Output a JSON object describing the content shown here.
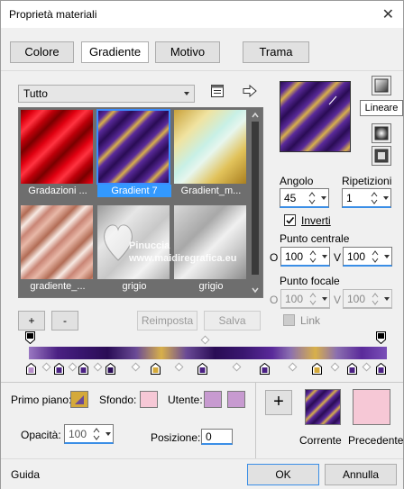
{
  "window": {
    "title": "Proprietà materiali",
    "close_glyph": "✕"
  },
  "tabs": [
    {
      "label": "Colore"
    },
    {
      "label": "Gradiente",
      "active": true
    },
    {
      "label": "Motivo"
    },
    {
      "label": "Trama"
    }
  ],
  "category": {
    "selected": "Tutto"
  },
  "gallery": {
    "items": [
      {
        "label": "Gradazioni ...",
        "style": "red"
      },
      {
        "label": "Gradient 7",
        "style": "purple-gold",
        "selected": true
      },
      {
        "label": "Gradient_m...",
        "style": "gold-mint"
      },
      {
        "label": "gradiente_...",
        "style": "pink-copper"
      },
      {
        "label": "grigio",
        "style": "gray"
      },
      {
        "label": "grigio",
        "style": "gray2"
      }
    ]
  },
  "watermark": {
    "line1": "Pinuccia",
    "line2": "www.maidiregrafica.eu"
  },
  "style_buttons": {
    "tooltip": "Lineare"
  },
  "angle": {
    "label": "Angolo",
    "value": "45"
  },
  "repeats": {
    "label": "Ripetizioni",
    "value": "1"
  },
  "invert": {
    "label": "Inverti",
    "checked": true
  },
  "center_point": {
    "label": "Punto centrale",
    "o_label": "O",
    "o_value": "100",
    "v_label": "V",
    "v_value": "100"
  },
  "focal_point": {
    "label": "Punto focale",
    "o_label": "O",
    "o_value": "100",
    "v_label": "V",
    "v_value": "100"
  },
  "link": {
    "label": "Link"
  },
  "editor_buttons": {
    "add": "+",
    "remove": "-",
    "reset": "Reimposta",
    "save": "Salva"
  },
  "bottom": {
    "foreground_label": "Primo piano:",
    "background_label": "Sfondo:",
    "user_label": "Utente:",
    "opacity_label": "Opacità:",
    "opacity_value": "100",
    "position_label": "Posizione:",
    "position_value": "0",
    "add_glyph": "+",
    "current_label": "Corrente",
    "previous_label": "Precedente"
  },
  "colors": {
    "purple": "#4b2183",
    "gold": "#d4a93a",
    "pink_bg": "#f6c8d6",
    "lilac": "#c79ad0",
    "selection_blue": "#3399ff"
  },
  "footer": {
    "help": "Guida",
    "ok": "OK",
    "cancel": "Annulla"
  }
}
